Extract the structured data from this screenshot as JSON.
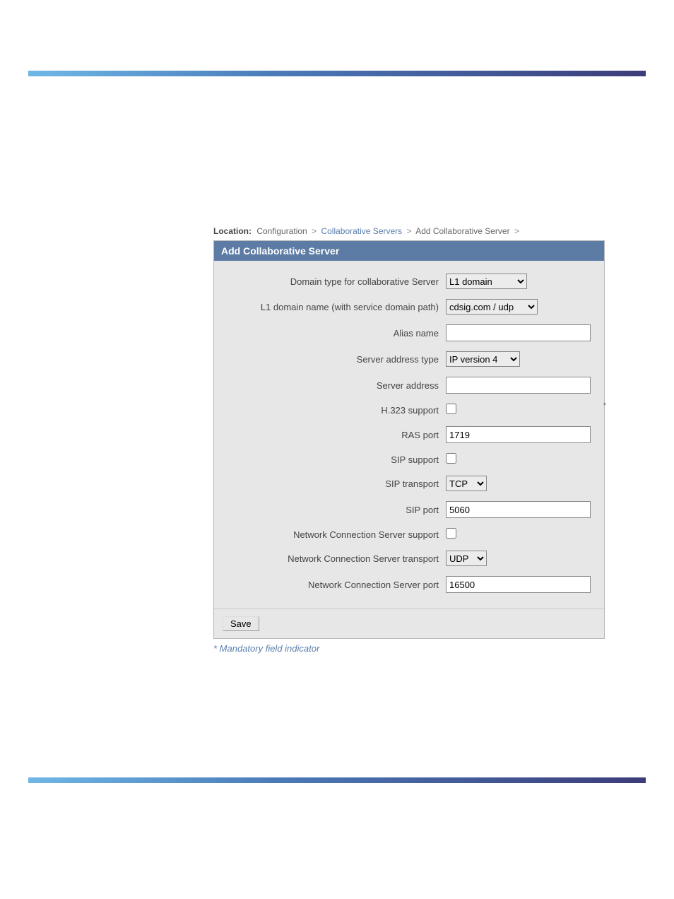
{
  "breadcrumb": {
    "label": "Location:",
    "item1": "Configuration",
    "item2": "Collaborative Servers",
    "item3": "Add Collaborative Server",
    "sep": ">"
  },
  "panel": {
    "title": "Add Collaborative Server"
  },
  "labels": {
    "domain_type": "Domain type for collaborative Server",
    "l1_domain_name": "L1 domain name (with service domain path)",
    "alias_name": "Alias name",
    "server_addr_type": "Server address type",
    "server_addr": "Server address",
    "h323": "H.323 support",
    "ras_port": "RAS port",
    "sip_support": "SIP support",
    "sip_transport": "SIP transport",
    "sip_port": "SIP port",
    "ncs_support": "Network Connection Server support",
    "ncs_transport": "Network Connection Server transport",
    "ncs_port": "Network Connection Server port"
  },
  "values": {
    "domain_type": "L1 domain",
    "l1_domain_name": "cdsig.com / udp",
    "alias_name": "",
    "server_addr_type": "IP version 4",
    "server_addr": "",
    "ras_port": "1719",
    "sip_transport": "TCP",
    "sip_port": "5060",
    "ncs_transport": "UDP",
    "ncs_port": "16500"
  },
  "buttons": {
    "save": "Save"
  },
  "notes": {
    "mandatory": "* Mandatory field indicator"
  }
}
